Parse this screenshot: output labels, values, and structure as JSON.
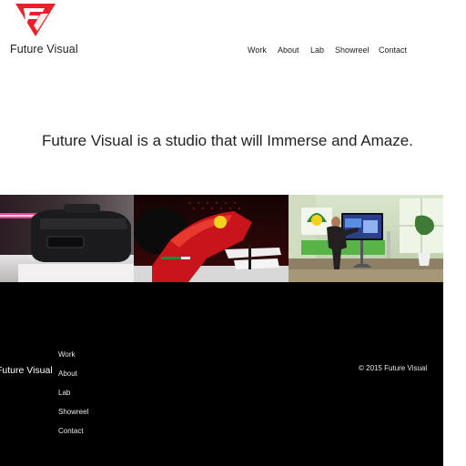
{
  "header": {
    "brand_name": "Future Visual",
    "logo_icon": "fv-logo-icon",
    "accent_color": "#e8202a"
  },
  "nav": {
    "items": [
      {
        "label": "Work"
      },
      {
        "label": "About"
      },
      {
        "label": "Lab"
      },
      {
        "label": "Showreel"
      },
      {
        "label": "Contact"
      }
    ]
  },
  "hero": {
    "tagline": "Future Visual is a studio that will Immerse and Amaze."
  },
  "gallery": {
    "images": [
      {
        "subject": "vr-headset-image"
      },
      {
        "subject": "race-car-image"
      },
      {
        "subject": "interactive-display-image"
      }
    ]
  },
  "footer": {
    "brand_name": "Future Visual",
    "links": [
      {
        "label": "Work"
      },
      {
        "label": "About"
      },
      {
        "label": "Lab"
      },
      {
        "label": "Showreel"
      },
      {
        "label": "Contact"
      }
    ],
    "copyright": "© 2015 Future Visual",
    "background_color": "#000000"
  }
}
